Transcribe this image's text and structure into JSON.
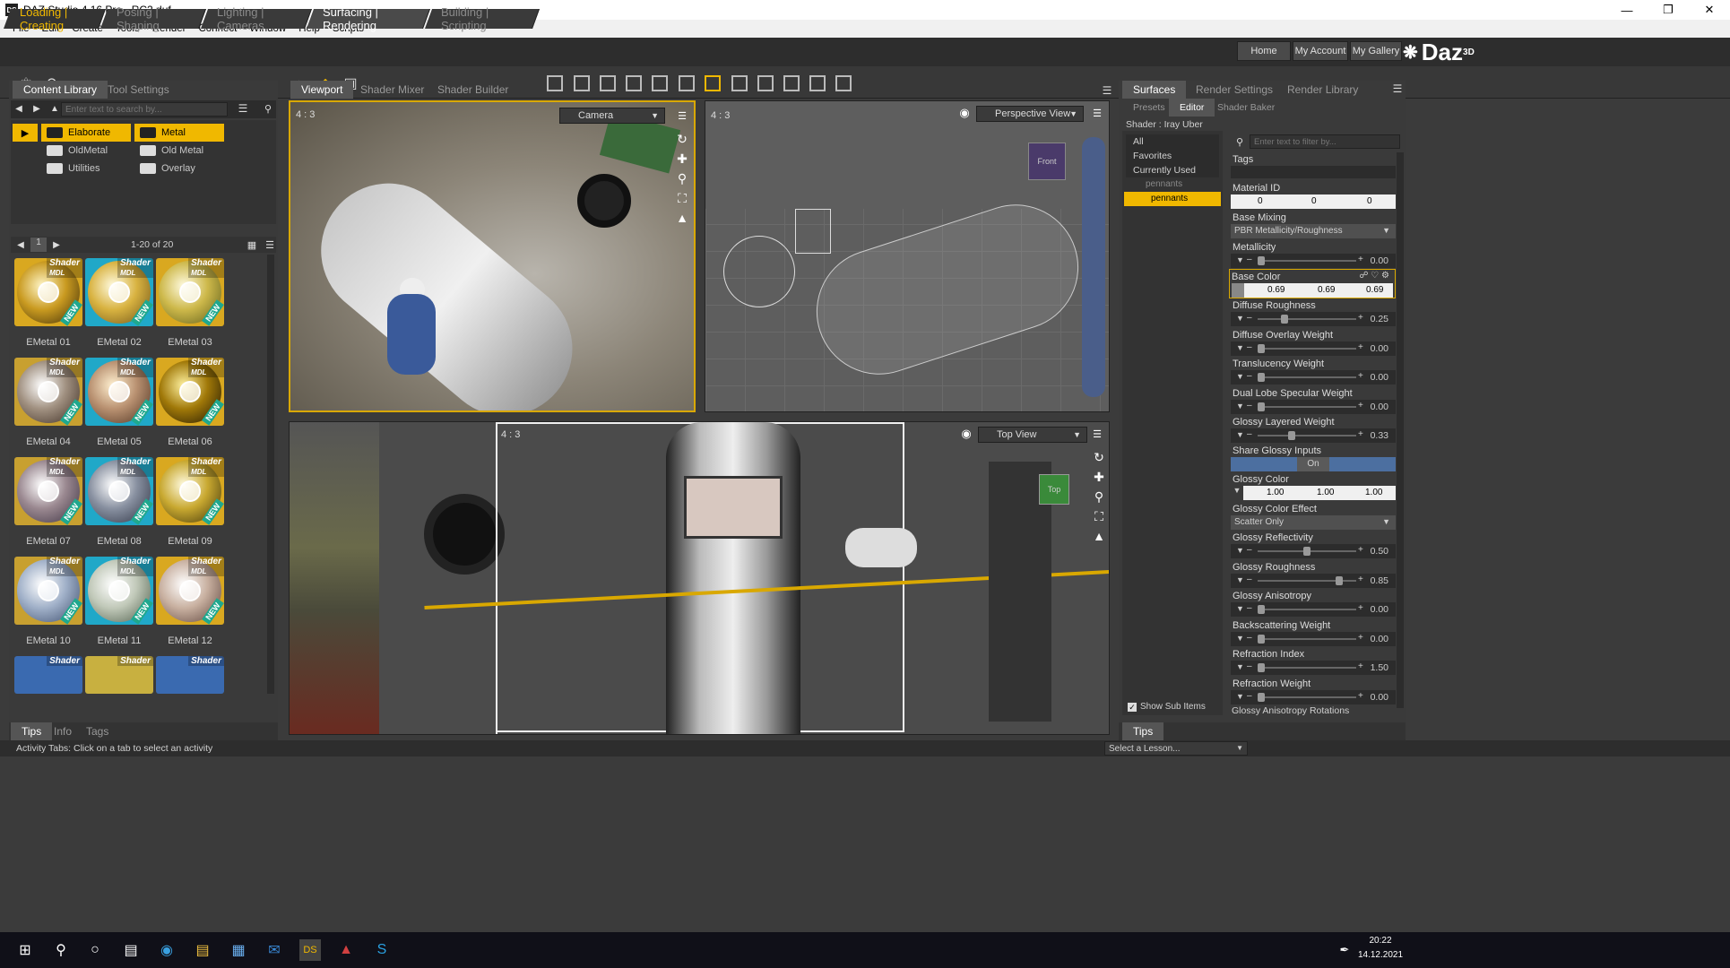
{
  "window": {
    "title": "DAZ Studio 4.16 Pro - RC2.duf",
    "app_icon": "DS"
  },
  "menu": [
    "File",
    "Edit",
    "Create",
    "Tools",
    "Render",
    "Connect",
    "Window",
    "Help",
    "Scripts"
  ],
  "activities": [
    "Loading | Creating",
    "Posing | Shaping",
    "Lighting | Cameras",
    "Surfacing | Rendering",
    "Building | Scripting"
  ],
  "brand": {
    "name": "Daz",
    "sup": "3D"
  },
  "header_buttons": [
    "Home",
    "My Account",
    "My Gallery"
  ],
  "left_panel": {
    "tabs": [
      "Content Library",
      "Tool Settings"
    ],
    "search_placeholder": "Enter text to search by...",
    "tree_col1": [
      "Elaborate",
      "OldMetal",
      "Utilities"
    ],
    "tree_col2": [
      "Metal",
      "Old Metal",
      "Overlay"
    ],
    "page_num": "1",
    "count": "1-20 of 20",
    "badge": "Shader",
    "badge_sub": "MDL",
    "new_tag": "NEW",
    "items": [
      "EMetal 01",
      "EMetal 02",
      "EMetal 03",
      "EMetal 04",
      "EMetal 05",
      "EMetal 06",
      "EMetal 07",
      "EMetal 08",
      "EMetal 09",
      "EMetal 10",
      "EMetal 11",
      "EMetal 12"
    ],
    "bottom_tabs": [
      "Tips",
      "Info",
      "Tags"
    ]
  },
  "center": {
    "tabs": [
      "Viewport",
      "Shader Mixer",
      "Shader Builder"
    ],
    "vp1": {
      "aspect": "4 : 3",
      "camera": "Camera"
    },
    "vp2": {
      "aspect": "4 : 3",
      "camera": "Perspective View",
      "cube_label": "Front"
    },
    "vp3": {
      "aspect": "4 : 3",
      "camera": "Top View",
      "cube_label": "Top"
    }
  },
  "right_panel": {
    "tabs": [
      "Surfaces",
      "Render Settings",
      "Render Library"
    ],
    "subtabs": [
      "Presets",
      "Editor",
      "Shader Baker"
    ],
    "shader_label": "Shader : Iray Uber",
    "filter_placeholder": "Enter text to filter by...",
    "tree": [
      "All",
      "Favorites",
      "Currently Used",
      "pennants",
      "pennants"
    ],
    "show_sub": "Show Sub Items",
    "tags_label": "Tags",
    "material_id_label": "Material ID",
    "material_id": [
      "0",
      "0",
      "0"
    ],
    "base_mixing_label": "Base Mixing",
    "base_mixing": "PBR Metallicity/Roughness",
    "base_color_label": "Base Color",
    "base_color": [
      "0.69",
      "0.69",
      "0.69"
    ],
    "glossy_color_label": "Glossy Color",
    "glossy_color": [
      "1.00",
      "1.00",
      "1.00"
    ],
    "share_glossy_label": "Share Glossy Inputs",
    "share_glossy": "On",
    "glossy_effect_label": "Glossy Color Effect",
    "glossy_effect": "Scatter Only",
    "props_a": [
      {
        "name": "Metallicity",
        "value": "0.00",
        "level": 0.0
      },
      {
        "name": "Diffuse Roughness",
        "value": "0.25",
        "level": 0.25
      },
      {
        "name": "Diffuse Overlay Weight",
        "value": "0.00",
        "level": 0.0
      },
      {
        "name": "Translucency Weight",
        "value": "0.00",
        "level": 0.0
      },
      {
        "name": "Dual Lobe Specular Weight",
        "value": "0.00",
        "level": 0.0
      },
      {
        "name": "Glossy Layered Weight",
        "value": "0.33",
        "level": 0.33
      }
    ],
    "props_b": [
      {
        "name": "Glossy Reflectivity",
        "value": "0.50",
        "level": 0.5
      },
      {
        "name": "Glossy Roughness",
        "value": "0.85",
        "level": 0.85
      },
      {
        "name": "Glossy Anisotropy",
        "value": "0.00",
        "level": 0.0
      },
      {
        "name": "Backscattering Weight",
        "value": "0.00",
        "level": 0.0
      },
      {
        "name": "Refraction Index",
        "value": "1.50",
        "level": 0.0
      },
      {
        "name": "Refraction Weight",
        "value": "0.00",
        "level": 0.0
      }
    ],
    "last_prop": "Glossy Anisotropy Rotations",
    "tips": "Tips",
    "lesson": "Select a Lesson..."
  },
  "status": "Activity Tabs: Click on a tab to select an activity",
  "taskbar": {
    "time": "20:22",
    "date": "14.12.2021"
  },
  "colors": {
    "accent": "#f0b800",
    "panel": "#3f3f3f",
    "dark": "#2c2c2c"
  }
}
